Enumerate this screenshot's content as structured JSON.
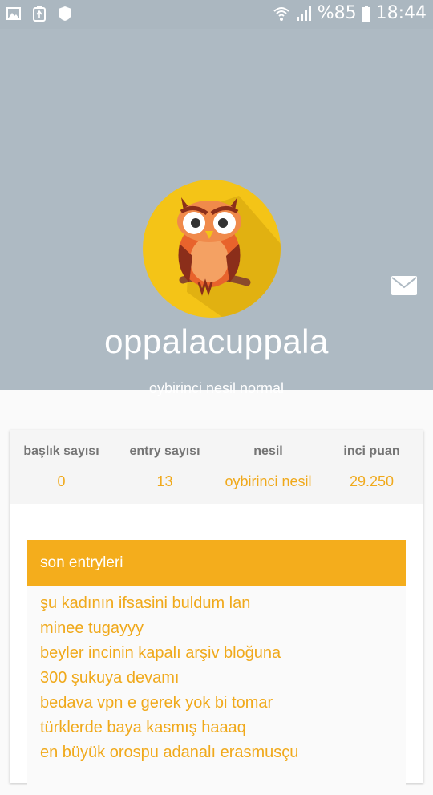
{
  "status_bar": {
    "icons_left": [
      "image-icon",
      "recycle-icon",
      "shield-icon"
    ],
    "battery_percent": "%85",
    "time": "18:44",
    "icons_right": [
      "wifi-icon",
      "signal-icon",
      "battery-icon"
    ]
  },
  "profile": {
    "username": "oppalacuppala",
    "subtitle": "oybirinci nesil normal",
    "avatar_icon": "owl-avatar-icon",
    "message_icon": "mail-icon"
  },
  "stats": [
    {
      "label": "başlık sayısı",
      "value": "0"
    },
    {
      "label": "entry sayısı",
      "value": "13"
    },
    {
      "label": "nesil",
      "value": "oybirinci nesil"
    },
    {
      "label": "inci puan",
      "value": "29.250"
    }
  ],
  "recent": {
    "title": "son entryleri",
    "items": [
      "şu kadının ifsasini buldum lan",
      "minee tugayyy",
      "beyler incinin kapalı arşiv bloğuna",
      "300 şukuya devamı",
      "bedava vpn e gerek yok bi tomar",
      "türklerde baya kasmış haaaq",
      "en büyük orospu adanalı erasmusçu"
    ]
  },
  "colors": {
    "header_bg": "#aebac3",
    "accent": "#f4ad1c",
    "value_text": "#f0a91b",
    "avatar_bg": "#f4c417"
  }
}
